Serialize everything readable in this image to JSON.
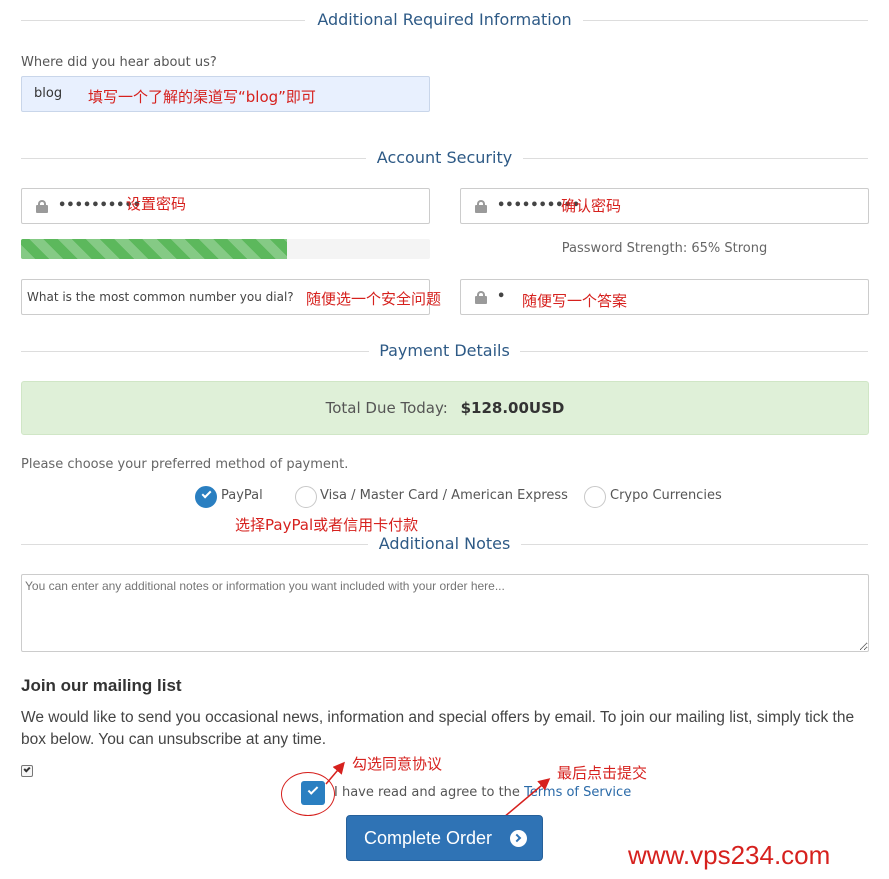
{
  "sections": {
    "additional_info": "Additional Required Information",
    "account_security": "Account Security",
    "payment_details": "Payment Details",
    "additional_notes": "Additional Notes"
  },
  "hear_about": {
    "label": "Where did you hear about us?",
    "value": "blog",
    "annotation": "填写一个了解的渠道写“blog”即可"
  },
  "password": {
    "masked": "••••••••••",
    "annotation": "设置密码"
  },
  "confirm_password": {
    "masked": "••••••••••",
    "annotation": "确认密码"
  },
  "strength": {
    "text": "Password Strength: 65% Strong",
    "percent": 65
  },
  "security_question": {
    "value": "What is the most common number you dial?",
    "annotation": "随便选一个安全问题"
  },
  "security_answer": {
    "masked": "•",
    "annotation": "随便写一个答案"
  },
  "total": {
    "label": "Total Due Today:",
    "amount": "$128.00USD"
  },
  "payment": {
    "prompt": "Please choose your preferred method of payment.",
    "methods": [
      "PayPal",
      "Visa / Master Card / American Express",
      "Crypo Currencies"
    ],
    "selected": "PayPal",
    "annotation": "选择PayPal或者信用卡付款"
  },
  "notes": {
    "placeholder": "You can enter any additional notes or information you want included with your order here..."
  },
  "mailing": {
    "title": "Join our mailing list",
    "text": "We would like to send you occasional news, information and special offers by email. To join our mailing list, simply tick the box below. You can unsubscribe at any time."
  },
  "terms": {
    "prefix": "I have read and agree to the ",
    "link": "Terms of Service",
    "annotation": "勾选同意协议"
  },
  "submit": {
    "label": "Complete Order",
    "annotation": "最后点击提交"
  },
  "watermark": "www.vps234.com",
  "colors": {
    "accent": "#2a7fc1",
    "heading": "#2e5a86",
    "annotation": "#d6211e",
    "strength_bar": "#5cb85c",
    "total_bg": "#dff0d8"
  }
}
